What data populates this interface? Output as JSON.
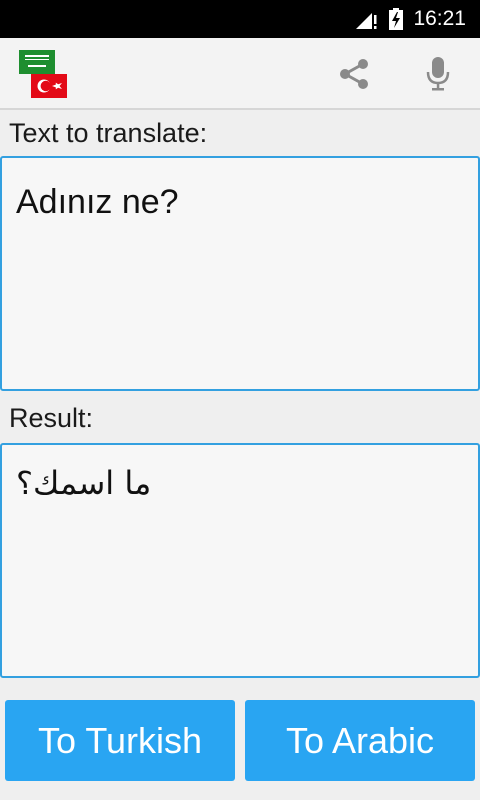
{
  "status_bar": {
    "time": "16:21",
    "icons": [
      "signal-icon",
      "battery-charging-icon"
    ]
  },
  "action_bar": {
    "flags": [
      "saudi-arabia-flag-icon",
      "turkey-flag-icon"
    ],
    "actions": [
      "share-icon",
      "microphone-icon"
    ]
  },
  "source": {
    "label": "Text to translate:",
    "text": "Adınız ne?"
  },
  "result": {
    "label": "Result:",
    "text": "ما اسمك؟"
  },
  "buttons": {
    "to_turkish": "To Turkish",
    "to_arabic": "To Arabic"
  },
  "colors": {
    "accent": "#29a5f2",
    "box_border": "#33a0e0",
    "status_bar": "#000000",
    "action_bar": "#f3f3f3",
    "sa_green": "#1e8e2f",
    "tr_red": "#e30a17"
  }
}
